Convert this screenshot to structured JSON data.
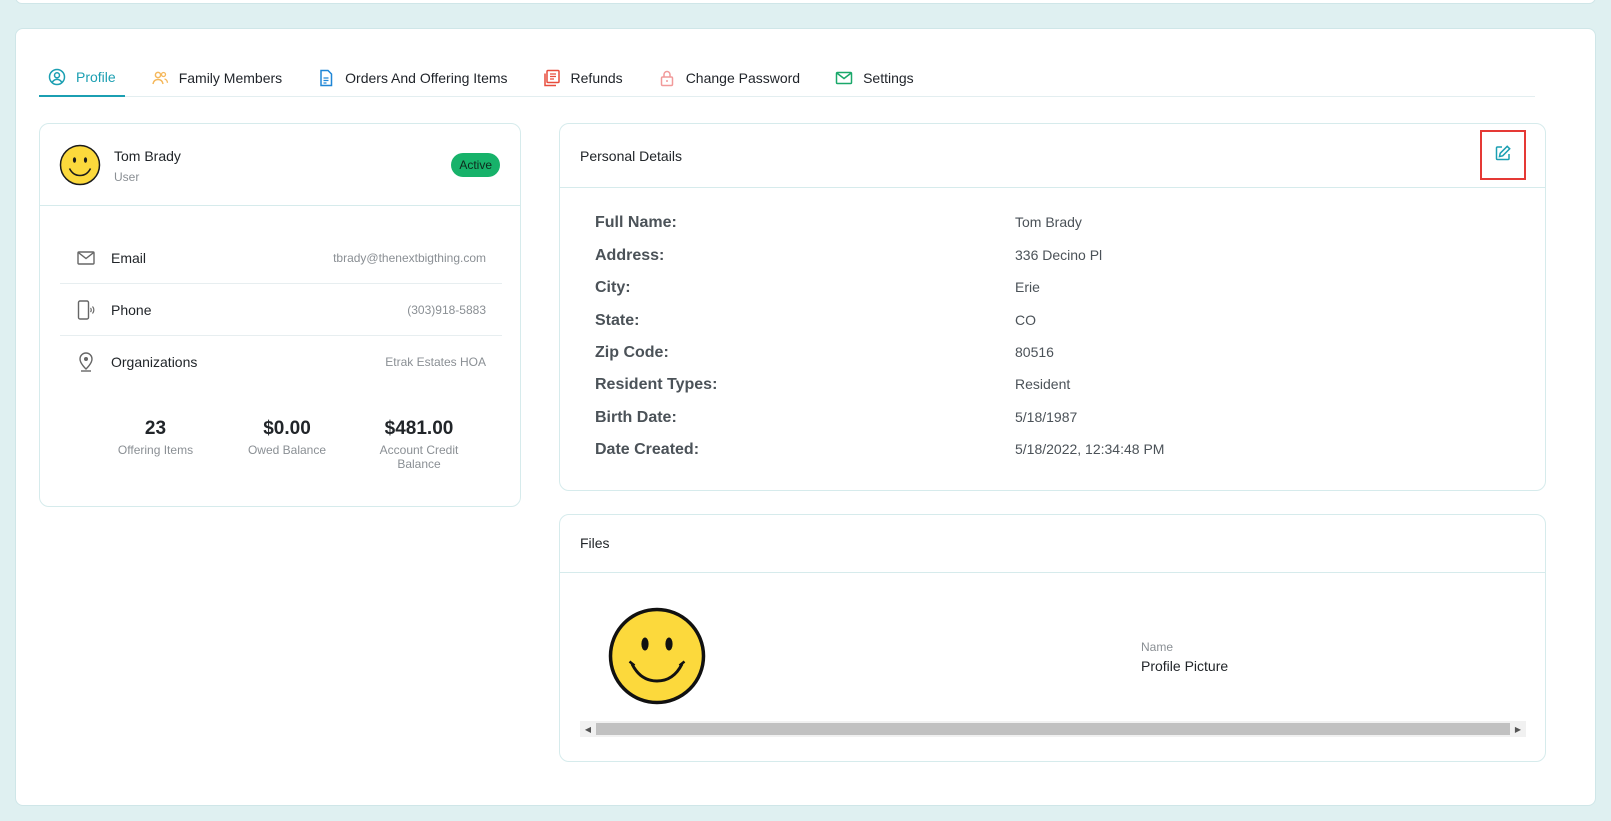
{
  "tabs": [
    {
      "label": "Profile",
      "icon": "user-circle-icon",
      "color": "#1b9fb2"
    },
    {
      "label": "Family Members",
      "icon": "users-icon",
      "color": "#f5b85c"
    },
    {
      "label": "Orders And Offering Items",
      "icon": "document-icon",
      "color": "#1f86d6"
    },
    {
      "label": "Refunds",
      "icon": "receipt-icon",
      "color": "#e74c3c"
    },
    {
      "label": "Change Password",
      "icon": "lock-icon",
      "color": "#f19a9a"
    },
    {
      "label": "Settings",
      "icon": "mail-icon",
      "color": "#1aa86a"
    }
  ],
  "profile": {
    "name": "Tom Brady",
    "role": "User",
    "status": "Active",
    "rows": [
      {
        "label": "Email",
        "value": "tbrady@thenextbigthing.com",
        "icon": "mail-icon"
      },
      {
        "label": "Phone",
        "value": "(303)918-5883",
        "icon": "phone-icon"
      },
      {
        "label": "Organizations",
        "value": "Etrak Estates HOA",
        "icon": "location-pin-icon"
      }
    ],
    "stats": [
      {
        "value": "23",
        "caption": "Offering Items"
      },
      {
        "value": "$0.00",
        "caption": "Owed Balance"
      },
      {
        "value": "$481.00",
        "caption": "Account Credit Balance"
      }
    ]
  },
  "details": {
    "title": "Personal Details",
    "rows": [
      {
        "key": "Full Name:",
        "value": "Tom Brady"
      },
      {
        "key": "Address:",
        "value": "336 Decino Pl"
      },
      {
        "key": "City:",
        "value": "Erie"
      },
      {
        "key": "State:",
        "value": "CO"
      },
      {
        "key": "Zip Code:",
        "value": "80516"
      },
      {
        "key": "Resident Types:",
        "value": "Resident"
      },
      {
        "key": "Birth Date:",
        "value": "5/18/1987"
      },
      {
        "key": "Date Created:",
        "value": "5/18/2022, 12:34:48 PM"
      }
    ]
  },
  "files": {
    "title": "Files",
    "name_caption": "Name",
    "name": "Profile Picture"
  },
  "colors": {
    "accent": "#1b9fb2",
    "active_badge": "#17b26a",
    "highlight_border": "#e53935"
  }
}
